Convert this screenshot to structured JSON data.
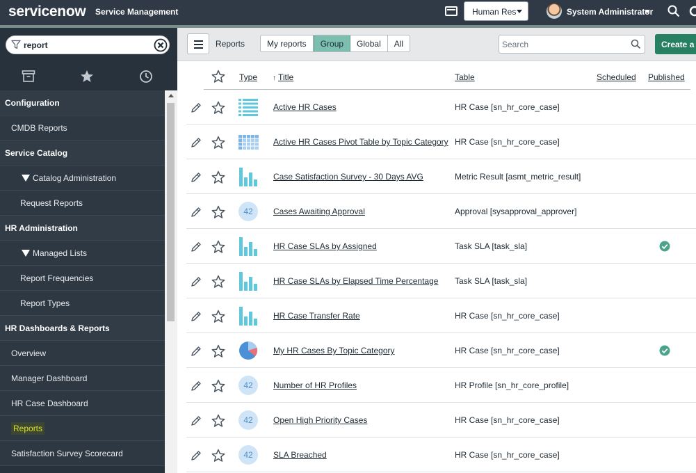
{
  "banner": {
    "logo_text": "servicenow",
    "app_title": "Service Management",
    "domain": "Human Res",
    "user_name": "System Administrator",
    "colors": {
      "background": "#303a46",
      "accent": "#7a8d89"
    }
  },
  "nav": {
    "filter_value": "report",
    "tabs": [
      {
        "name": "all-applications",
        "icon": "archive-icon"
      },
      {
        "name": "favorites",
        "icon": "star-icon"
      },
      {
        "name": "history",
        "icon": "clock-icon"
      }
    ],
    "items": [
      {
        "kind": "section",
        "label": "Configuration"
      },
      {
        "kind": "mod",
        "label": "CMDB Reports"
      },
      {
        "kind": "section",
        "label": "Service Catalog"
      },
      {
        "kind": "sub",
        "label": "Catalog Administration"
      },
      {
        "kind": "subitem",
        "label": "Request Reports"
      },
      {
        "kind": "section",
        "label": "HR Administration"
      },
      {
        "kind": "sub",
        "label": "Managed Lists"
      },
      {
        "kind": "subitem",
        "label": "Report Frequencies"
      },
      {
        "kind": "subitem",
        "label": "Report Types"
      },
      {
        "kind": "section",
        "label": "HR Dashboards & Reports"
      },
      {
        "kind": "mod",
        "label": "Overview"
      },
      {
        "kind": "mod",
        "label": "Manager Dashboard"
      },
      {
        "kind": "mod",
        "label": "HR Case Dashboard"
      },
      {
        "kind": "mod",
        "label": "Reports",
        "highlight": true
      },
      {
        "kind": "mod",
        "label": "Satisfaction Survey Scorecard"
      }
    ]
  },
  "list": {
    "title": "Reports",
    "filters": [
      {
        "label": "My reports",
        "active": false
      },
      {
        "label": "Group",
        "active": true
      },
      {
        "label": "Global",
        "active": false
      },
      {
        "label": "All",
        "active": false
      }
    ],
    "search_placeholder": "Search",
    "create_label": "Create a report",
    "columns": {
      "type": "Type",
      "title": "Title",
      "table": "Table",
      "scheduled": "Scheduled",
      "published": "Published"
    },
    "rows": [
      {
        "type": "list",
        "title": "Active HR Cases",
        "table": "HR Case [sn_hr_core_case]",
        "published": false
      },
      {
        "type": "pivot",
        "title": "Active HR Cases Pivot Table by Topic Category",
        "table": "HR Case [sn_hr_core_case]",
        "published": false
      },
      {
        "type": "bar",
        "title": "Case Satisfaction Survey - 30 Days AVG",
        "table": "Metric Result [asmt_metric_result]",
        "published": false
      },
      {
        "type": "single-score",
        "score": "42",
        "title": "Cases Awaiting Approval",
        "table": "Approval [sysapproval_approver]",
        "published": false
      },
      {
        "type": "bar",
        "title": "HR Case SLAs by Assigned",
        "table": "Task SLA [task_sla]",
        "published": true
      },
      {
        "type": "bar",
        "title": "HR Case SLAs by Elapsed Time Percentage",
        "table": "Task SLA [task_sla]",
        "published": false
      },
      {
        "type": "bar",
        "title": "HR Case Transfer Rate",
        "table": "HR Case [sn_hr_core_case]",
        "published": false
      },
      {
        "type": "pie",
        "title": "My HR Cases By Topic Category",
        "table": "HR Case [sn_hr_core_case]",
        "published": true
      },
      {
        "type": "single-score",
        "score": "42",
        "title": "Number of HR Profiles",
        "table": "HR Profile [sn_hr_core_profile]",
        "published": false
      },
      {
        "type": "single-score",
        "score": "42",
        "title": "Open High Priority Cases",
        "table": "HR Case [sn_hr_core_case]",
        "published": false
      },
      {
        "type": "single-score",
        "score": "42",
        "title": "SLA Breached",
        "table": "HR Case [sn_hr_core_case]",
        "published": false
      }
    ],
    "colors": {
      "chart": "#5fc8dc",
      "published": "#4aa38a",
      "score_bg": "#cfe4f6",
      "pie_primary": "#4b90d6",
      "pie_accent": "#e7717a"
    }
  }
}
